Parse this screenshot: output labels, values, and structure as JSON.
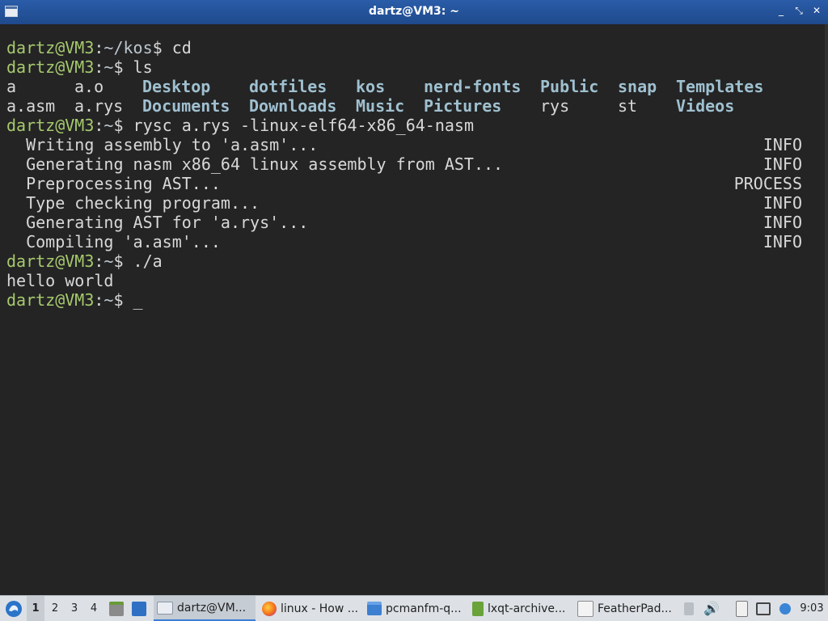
{
  "window": {
    "title": "dartz@VM3: ~",
    "controls": {
      "minimize": "_",
      "restore": "⤡",
      "close": "✕"
    }
  },
  "terminal": {
    "prompt_user": "dartz@VM3",
    "sep": ":",
    "cmd1": {
      "path": "~/kos",
      "dollar": "$",
      "command": " cd"
    },
    "cmd2": {
      "path": "~",
      "dollar": "$",
      "command": " ls"
    },
    "ls_row1": [
      "a",
      "a.o",
      "Desktop",
      "dotfiles",
      "kos",
      "nerd-fonts",
      "Public",
      "snap",
      "Templates"
    ],
    "ls_row2": [
      "a.asm",
      "a.rys",
      "Documents",
      "Downloads",
      "Music",
      "Pictures",
      "rys",
      "st",
      "Videos"
    ],
    "cmd3": {
      "path": "~",
      "dollar": "$",
      "command": " rysc a.rys -linux-elf64-x86_64-nasm"
    },
    "log": [
      {
        "msg": "  Writing assembly to 'a.asm'...",
        "level": "INFO"
      },
      {
        "msg": "  Generating nasm x86_64 linux assembly from AST...",
        "level": "INFO"
      },
      {
        "msg": "  Preprocessing AST...",
        "level": "PROCESS"
      },
      {
        "msg": "  Type checking program...",
        "level": "INFO"
      },
      {
        "msg": "  Generating AST for 'a.rys'...",
        "level": "INFO"
      },
      {
        "msg": "  Compiling 'a.asm'...",
        "level": "INFO"
      }
    ],
    "cmd4": {
      "path": "~",
      "dollar": "$",
      "command": " ./a"
    },
    "output": "hello world",
    "cmd5": {
      "path": "~",
      "dollar": "$",
      "command": " _"
    }
  },
  "taskbar": {
    "desktops": [
      "1",
      "2",
      "3",
      "4"
    ],
    "tasks": [
      {
        "label": "dartz@VM...",
        "icon": "terminal-icon"
      },
      {
        "label": "linux - How ...",
        "icon": "firefox-icon"
      },
      {
        "label": "pcmanfm-q...",
        "icon": "folder-icon"
      },
      {
        "label": "lxqt-archive...",
        "icon": "archive-icon"
      },
      {
        "label": "FeatherPad...",
        "icon": "featherpad-icon"
      }
    ],
    "clock": "9:03"
  }
}
